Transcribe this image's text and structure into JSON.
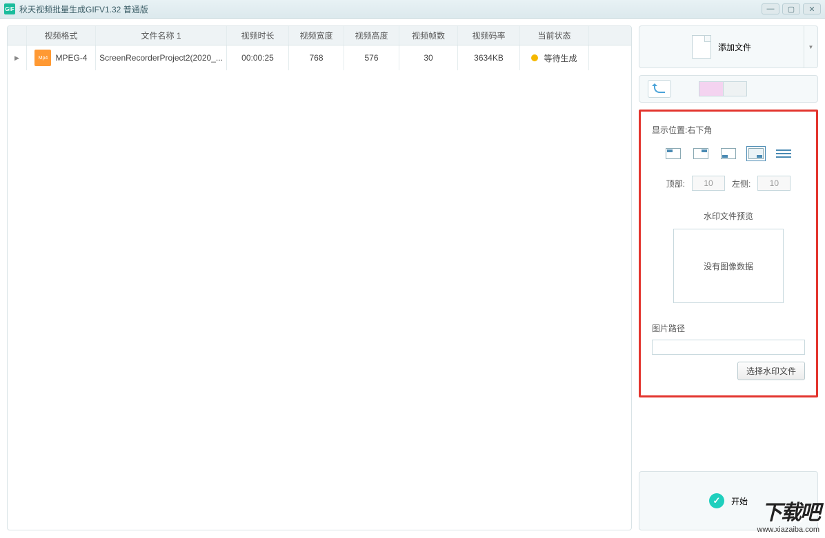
{
  "window": {
    "title": "秋天视频批量生成GIFV1.32 普通版",
    "icon_text": "GIF"
  },
  "table": {
    "headers": {
      "format": "视频格式",
      "name": "文件名称 1",
      "duration": "视频时长",
      "width": "视频宽度",
      "height": "视频高度",
      "fps": "视频帧数",
      "bitrate": "视频码率",
      "status": "当前状态"
    },
    "row": {
      "icon_text": "Mp4",
      "format": "MPEG-4",
      "name": "ScreenRecorderProject2(2020_...",
      "duration": "00:00:25",
      "width": "768",
      "height": "576",
      "fps": "30",
      "bitrate": "3634KB",
      "status": "等待生成"
    }
  },
  "side": {
    "add_file": "添加文件",
    "position_label": "显示位置:右下角",
    "top_label": "顶部:",
    "top_value": "10",
    "left_label": "左侧:",
    "left_value": "10",
    "preview_label": "水印文件预览",
    "preview_empty": "没有图像数据",
    "path_label": "图片路径",
    "path_value": "",
    "choose_file": "选择水印文件",
    "start": "开始"
  },
  "watermark_site": {
    "big": "下载吧",
    "small": "www.xiazaiba.com"
  }
}
